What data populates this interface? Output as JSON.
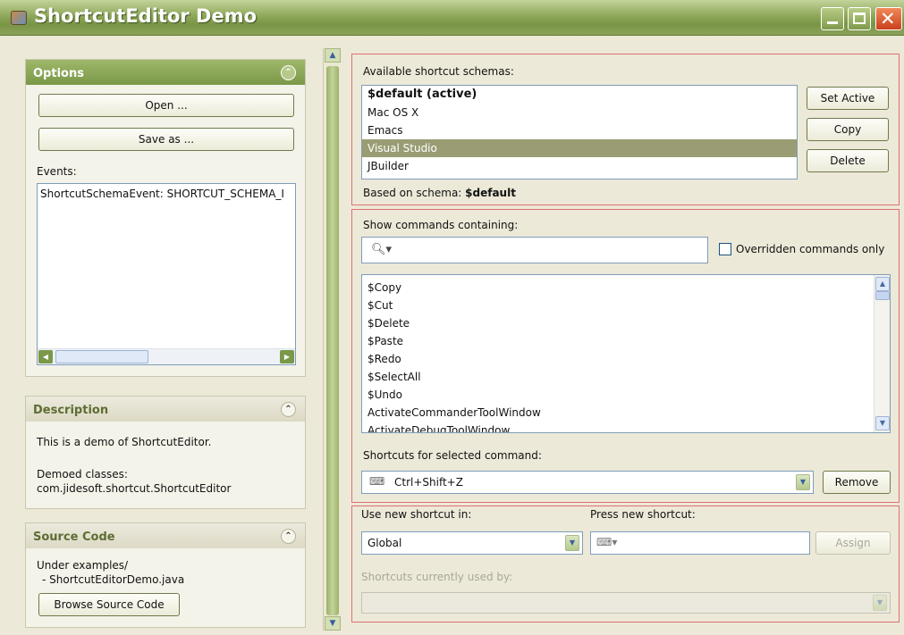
{
  "window": {
    "title": "ShortcutEditor Demo"
  },
  "options": {
    "header": "Options",
    "open_label": "Open ...",
    "save_label": "Save as ...",
    "events_label": "Events:",
    "events": [
      "ShortcutSchemaEvent: SHORTCUT_SCHEMA_I"
    ]
  },
  "description": {
    "header": "Description",
    "line1": "This is a demo of ShortcutEditor.",
    "line2": "Demoed classes:",
    "line3": "com.jidesoft.shortcut.ShortcutEditor"
  },
  "source": {
    "header": "Source Code",
    "line1": "Under examples/",
    "line2": "- ShortcutEditorDemo.java",
    "browse_label": "Browse Source Code"
  },
  "schemas": {
    "label": "Available shortcut schemas:",
    "items": [
      "$default (active)",
      "Mac OS X",
      "Emacs",
      "Visual Studio",
      "JBuilder"
    ],
    "selected": "Visual Studio",
    "set_active": "Set Active",
    "copy": "Copy",
    "delete": "Delete",
    "based_on_prefix": "Based on schema: ",
    "based_on_value": "$default"
  },
  "commands": {
    "label": "Show commands containing:",
    "search_value": "",
    "overridden_label": "Overridden commands only",
    "overridden_checked": false,
    "items": [
      "$Copy",
      "$Cut",
      "$Delete",
      "$Paste",
      "$Redo",
      "$SelectAll",
      "$Undo",
      "ActivateCommanderToolWindow",
      "ActivateDebugToolWindow"
    ],
    "shortcuts_label": "Shortcuts for selected command:",
    "shortcut_value": "Ctrl+Shift+Z",
    "remove": "Remove"
  },
  "assign": {
    "use_in_label": "Use new shortcut in:",
    "use_in_value": "Global",
    "press_label": "Press new shortcut:",
    "assign_label": "Assign",
    "used_by_label": "Shortcuts currently used by:"
  },
  "icons": {
    "search": "search-icon",
    "keyboard": "keyboard-icon",
    "chevron": "chevron-up-icon"
  }
}
